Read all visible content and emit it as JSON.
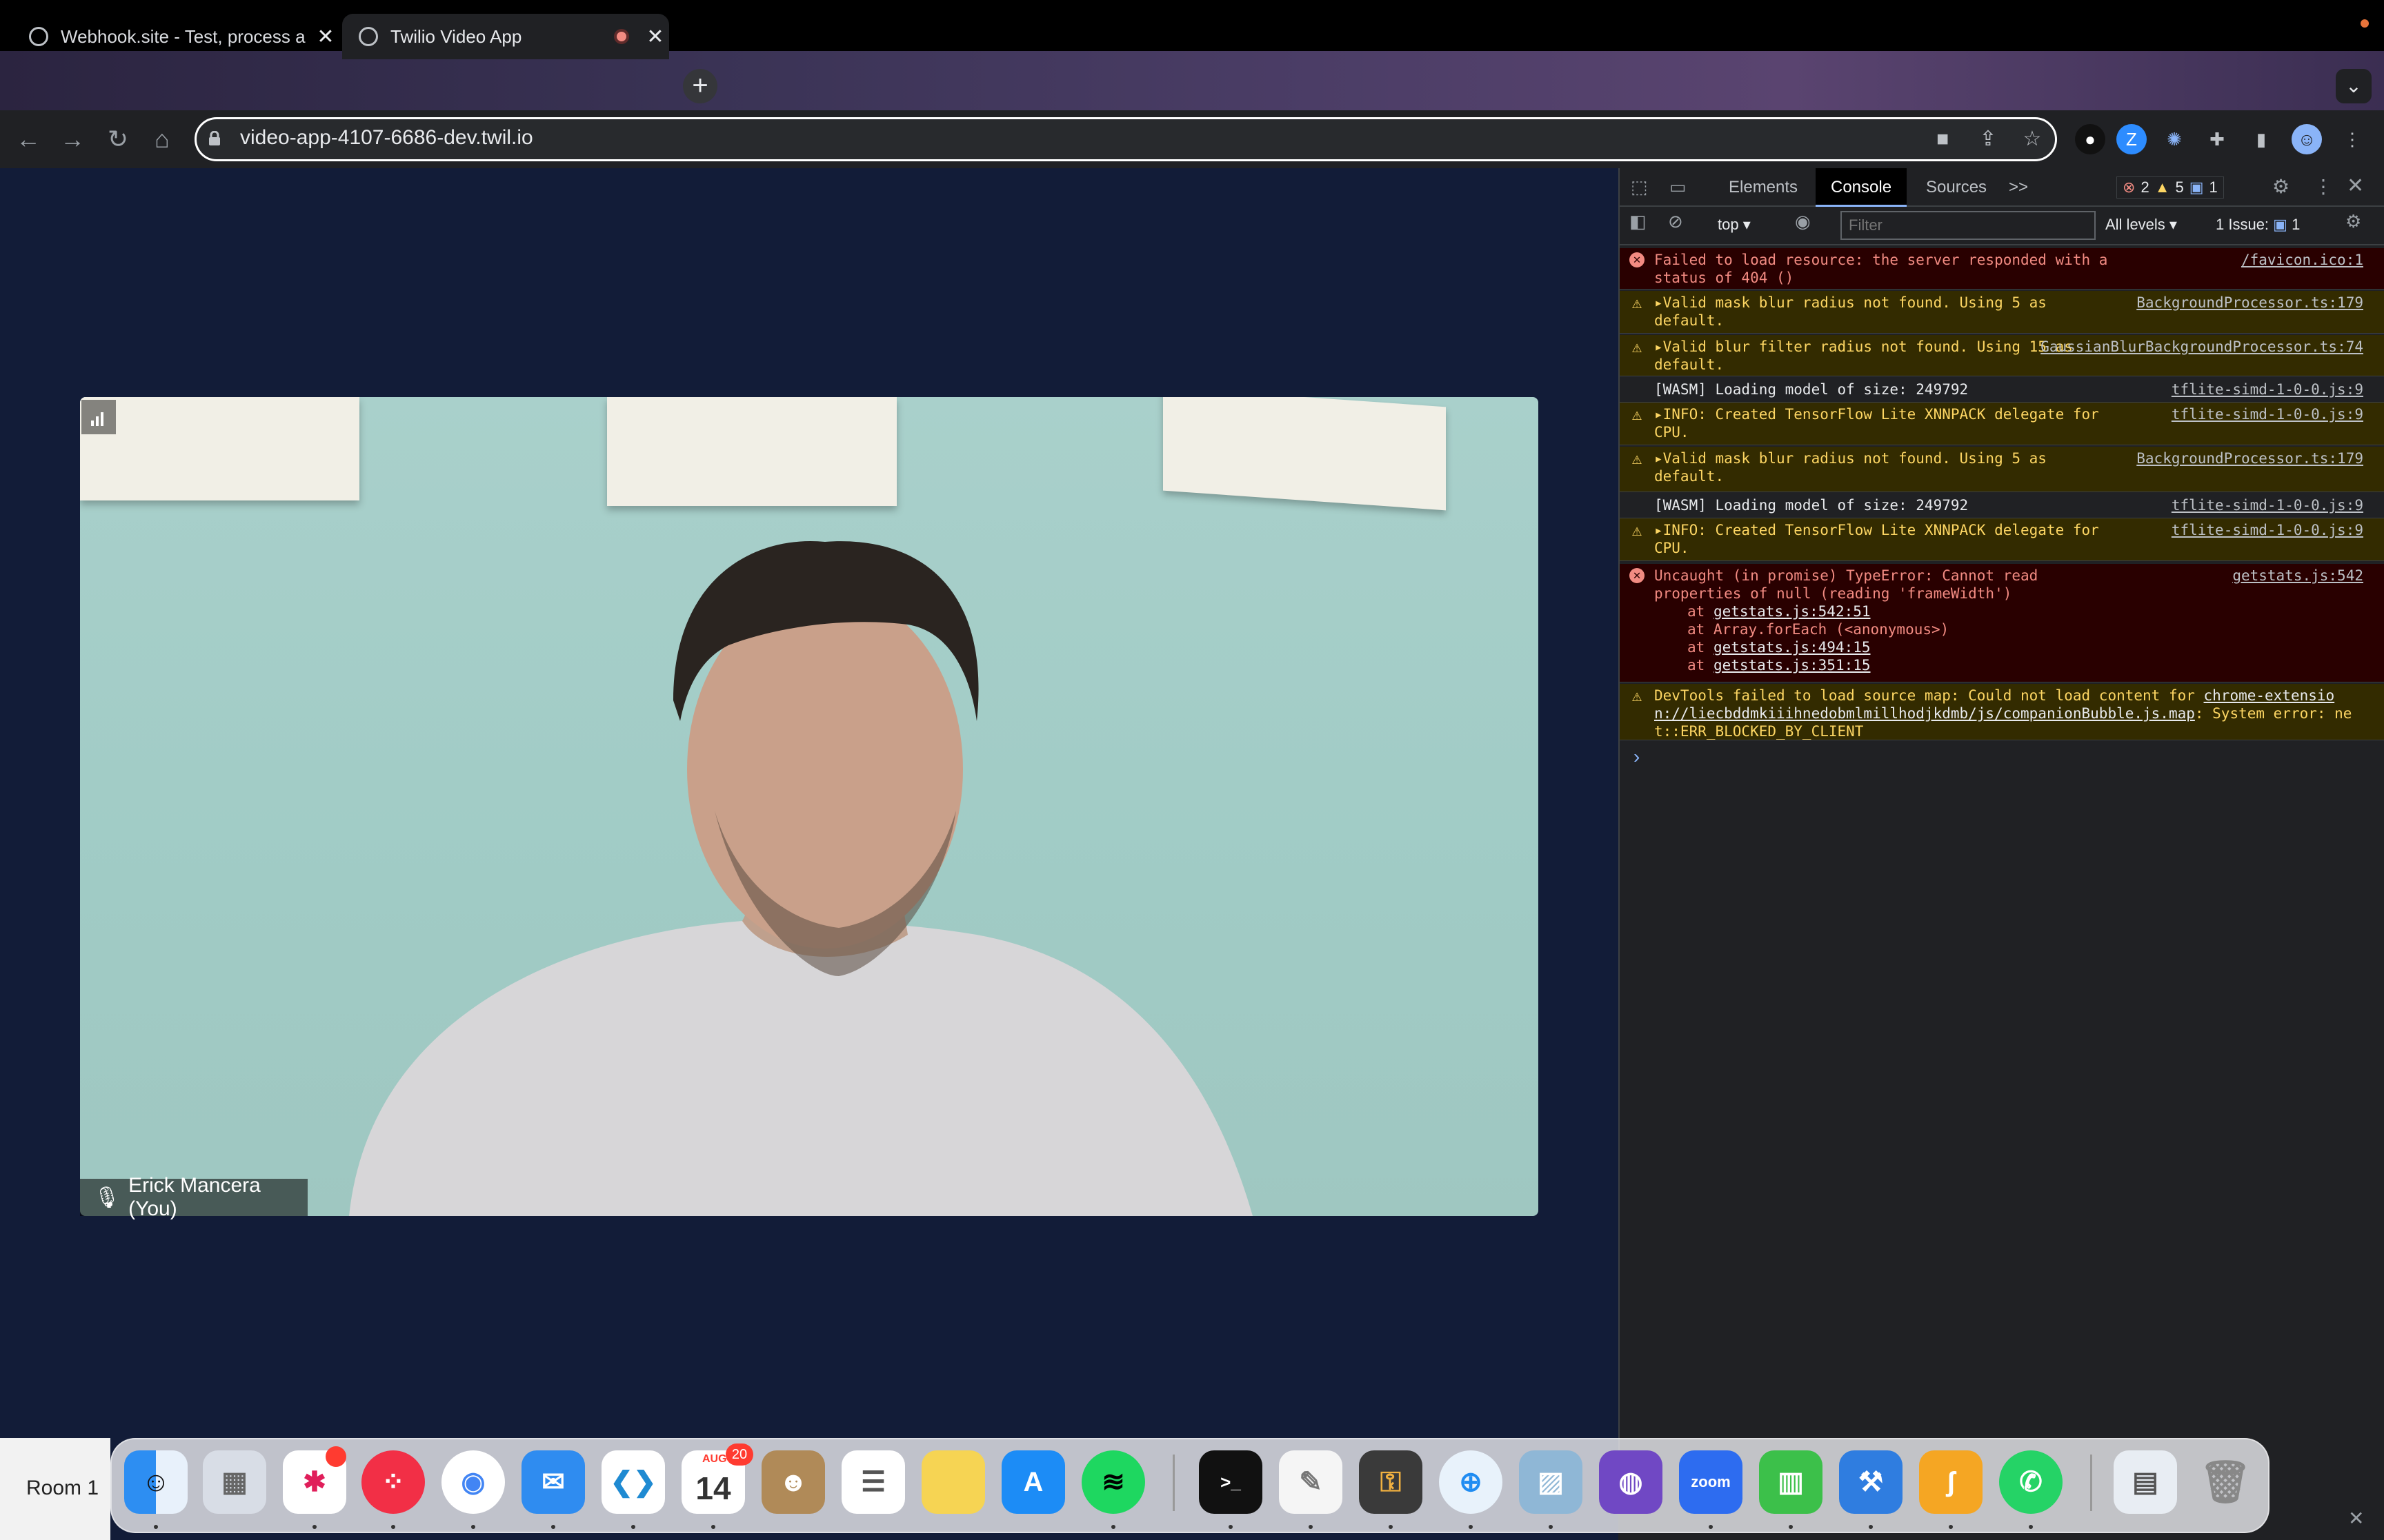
{
  "browser": {
    "tabs": [
      {
        "title": "Webhook.site - Test, process a",
        "active": false
      },
      {
        "title": "Twilio Video App",
        "active": true
      }
    ],
    "url": "video-app-4107-6686-dev.twil.io"
  },
  "video": {
    "participant_name": "Erick Mancera (You)"
  },
  "devtools": {
    "tabs": [
      "Elements",
      "Console",
      "Sources"
    ],
    "more_tabs": ">>",
    "counts": {
      "errors": "2",
      "warnings": "5",
      "messages": "1"
    },
    "context": "top",
    "filter_placeholder": "Filter",
    "levels": "All levels",
    "issues_label": "1 Issue:",
    "issues_count": "1",
    "messages": [
      {
        "level": "error",
        "text": "Failed to load resource: the server responded with a status of 404 ()",
        "source": "/favicon.ico:1"
      },
      {
        "level": "warn",
        "text": "▸Valid mask blur radius not found. Using 5 as default.",
        "source": "BackgroundProcessor.ts:179"
      },
      {
        "level": "warn",
        "text": "▸Valid blur filter radius not found. Using 15 as default.",
        "source": "GaussianBlurBackgroundProcessor.ts:74"
      },
      {
        "level": "info",
        "text": "[WASM] Loading model of size: 249792",
        "source": "tflite-simd-1-0-0.js:9"
      },
      {
        "level": "warn",
        "text": "▸INFO: Created TensorFlow Lite XNNPACK delegate for CPU.",
        "source": "tflite-simd-1-0-0.js:9"
      },
      {
        "level": "warn",
        "text": "▸Valid mask blur radius not found. Using 5 as default.",
        "source": "BackgroundProcessor.ts:179"
      },
      {
        "level": "info",
        "text": "[WASM] Loading model of size: 249792",
        "source": "tflite-simd-1-0-0.js:9"
      },
      {
        "level": "warn",
        "text": "▸INFO: Created TensorFlow Lite XNNPACK delegate for CPU.",
        "source": "tflite-simd-1-0-0.js:9"
      },
      {
        "level": "error",
        "text": "Uncaught (in promise) TypeError: Cannot read properties of null (reading 'frameWidth')",
        "source": "getstats.js:542",
        "stack": [
          {
            "prefix": "at ",
            "link": "getstats.js:542:51"
          },
          {
            "prefix": "at Array.forEach (<anonymous>)",
            "link": ""
          },
          {
            "prefix": "at ",
            "link": "getstats.js:494:15"
          },
          {
            "prefix": "at ",
            "link": "getstats.js:351:15"
          }
        ]
      },
      {
        "level": "warn",
        "text": "DevTools failed to load source map: Could not load content for ",
        "link": "chrome-extension://liecbddmkiiihnedobmlmillhodjkdmb/js/companionBubble.js.map",
        "tail": ": System error: net::ERR_BLOCKED_BY_CLIENT",
        "source": ""
      }
    ],
    "prompt": "›"
  },
  "dock": {
    "room_label": "Room 1",
    "calendar_month": "AUG",
    "calendar_day": "14",
    "calendar_badge": "20",
    "zoom_label": "zoom"
  },
  "colors": {
    "page_bg": "#121c38",
    "devtools_bg": "#202124",
    "error_bg": "#290000",
    "warn_bg": "#332b00"
  }
}
